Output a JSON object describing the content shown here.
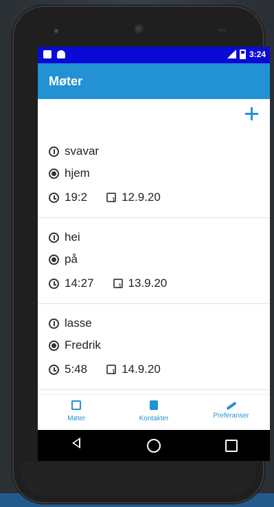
{
  "status_bar": {
    "time": "3:24",
    "network": "LTE"
  },
  "app_bar": {
    "title": "Møter"
  },
  "add_button": {
    "label": "+"
  },
  "meetings": [
    {
      "title": "svavar",
      "location": "hjem",
      "time": "19:2",
      "date": "12.9.20"
    },
    {
      "title": "hei",
      "location": "på",
      "time": "14:27",
      "date": "13.9.20"
    },
    {
      "title": "lasse",
      "location": "Fredrik",
      "time": "5:48",
      "date": "14.9.20"
    }
  ],
  "bottom_nav": [
    {
      "label": "Møter",
      "icon": "calendar-icon"
    },
    {
      "label": "Kontakter",
      "icon": "contacts-icon"
    },
    {
      "label": "Preferanser",
      "icon": "wrench-icon"
    }
  ],
  "colors": {
    "accent": "#2292d4",
    "status_bar": "#0a0ad6",
    "nav_bar": "#000000"
  }
}
